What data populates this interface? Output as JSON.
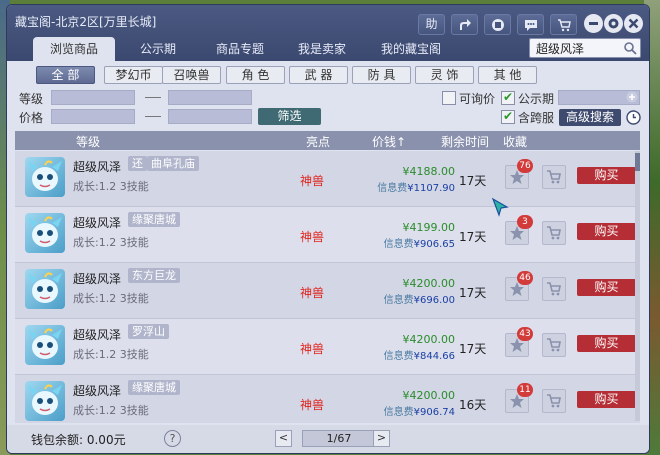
{
  "window": {
    "title": "藏宝阁-北京2区[万里长城]",
    "controls": [
      "助",
      "share-icon",
      "record-icon",
      "chat-icon",
      "cart-icon"
    ],
    "window_buttons": [
      "minimize-icon",
      "settings-icon",
      "close-icon"
    ]
  },
  "tabs": [
    {
      "label": "浏览商品",
      "active": true
    },
    {
      "label": "公示期",
      "active": false
    },
    {
      "label": "商品专题",
      "active": false
    },
    {
      "label": "我是卖家",
      "active": false
    },
    {
      "label": "我的藏宝阁",
      "active": false
    }
  ],
  "search": {
    "value": "超级风泽"
  },
  "categories": [
    {
      "label": "全 部",
      "active": true
    },
    {
      "label": "梦幻币",
      "active": false
    },
    {
      "label": "召唤兽",
      "active": false
    },
    {
      "label": "角 色",
      "active": false
    },
    {
      "label": "武 器",
      "active": false
    },
    {
      "label": "防 具",
      "active": false
    },
    {
      "label": "灵 饰",
      "active": false
    },
    {
      "label": "其 他",
      "active": false
    }
  ],
  "filters": {
    "level_label": "等级",
    "price_label": "价格",
    "filter_button": "筛选",
    "inquiry_label": "可询价",
    "inquiry_checked": false,
    "public_label": "公示期",
    "public_checked": true,
    "cross_label": "含跨服",
    "cross_checked": true,
    "advanced_button": "高级搜索"
  },
  "table": {
    "headers": {
      "level": "等级",
      "highlight": "亮点",
      "price": "价钱↑",
      "remaining": "剩余时间",
      "favorite": "收藏"
    },
    "rows": [
      {
        "name": "超级风泽",
        "tags": [
          "还",
          "曲阜孔庙"
        ],
        "growth": "成长:1.2 3技能",
        "type": "神兽",
        "price": "¥4188.00",
        "fee_label": "信息费",
        "fee": "¥1107.90",
        "days": "17天",
        "fav_count": "76",
        "buy": "购买"
      },
      {
        "name": "超级风泽",
        "tags": [
          "缘聚唐城"
        ],
        "growth": "成长:1.2 3技能",
        "type": "神兽",
        "price": "¥4199.00",
        "fee_label": "信息费",
        "fee": "¥906.65",
        "days": "17天",
        "fav_count": "3",
        "buy": "购买"
      },
      {
        "name": "超级风泽",
        "tags": [
          "东方巨龙"
        ],
        "growth": "成长:1.2 3技能",
        "type": "神兽",
        "price": "¥4200.00",
        "fee_label": "信息费",
        "fee": "¥696.00",
        "days": "17天",
        "fav_count": "46",
        "buy": "购买"
      },
      {
        "name": "超级风泽",
        "tags": [
          "罗浮山"
        ],
        "growth": "成长:1.2 3技能",
        "type": "神兽",
        "price": "¥4200.00",
        "fee_label": "信息费",
        "fee": "¥844.66",
        "days": "17天",
        "fav_count": "43",
        "buy": "购买"
      },
      {
        "name": "超级风泽",
        "tags": [
          "缘聚唐城"
        ],
        "growth": "成长:1.2 3技能",
        "type": "神兽",
        "price": "¥4200.00",
        "fee_label": "信息费",
        "fee": "¥906.74",
        "days": "16天",
        "fav_count": "11",
        "buy": "购买"
      }
    ]
  },
  "footer": {
    "balance": "钱包余额: 0.00元",
    "help": "?",
    "prev": "<",
    "next": ">",
    "page": "1/67"
  },
  "colors": {
    "title_bar": "#3b4870",
    "buy_button": "#b52e36",
    "divine_beast": "#e0241e",
    "price": "#2a8c2a"
  }
}
